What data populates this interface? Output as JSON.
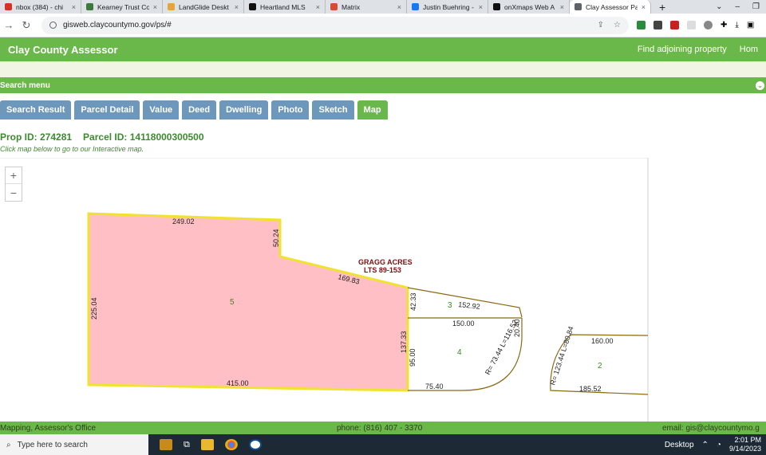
{
  "browser": {
    "tabs": [
      {
        "label": "nbox (384) - chi",
        "color": "#d93025"
      },
      {
        "label": "Kearney Trust Co",
        "color": "#3c7a3c"
      },
      {
        "label": "LandGlide Deskt",
        "color": "#e8a33d"
      },
      {
        "label": "Heartland MLS",
        "color": "#111111"
      },
      {
        "label": "Matrix",
        "color": "#d24e34"
      },
      {
        "label": "Justin Buehring -",
        "color": "#1877f2"
      },
      {
        "label": "onXmaps Web A",
        "color": "#111111"
      },
      {
        "label": "Clay Assessor Pa",
        "color": "#5f6368"
      }
    ],
    "url": "gisweb.claycountymo.gov/ps/#"
  },
  "app": {
    "title": "Clay County Assessor",
    "links": [
      "Find adjoining property",
      "Hom"
    ],
    "search_menu": "Search menu"
  },
  "nav_tabs": [
    "Search Result",
    "Parcel Detail",
    "Value",
    "Deed",
    "Dwelling",
    "Photo",
    "Sketch",
    "Map"
  ],
  "property": {
    "prop_id": "Prop ID: 274281",
    "parcel_id": "Parcel ID: 14118000300500",
    "hint": "Click map below to go to our Interactive map."
  },
  "map": {
    "subdivision": "GRAGG ACRES",
    "lots": "LTS 89-153",
    "lot_numbers": {
      "selected": "5",
      "lot3": "3",
      "lot4": "4",
      "lot2": "2"
    },
    "dims": {
      "top": "249.02",
      "notch": "50.24",
      "diag": "169.83",
      "left": "225.04",
      "bottom": "415.00",
      "right_upper": "42.33",
      "right_lower": "137.33",
      "l3_top": "152.92",
      "l3_bottom": "150.00",
      "l3_right": "20.40",
      "l4_left": "95.00",
      "l4_bottom": "75.40",
      "l4_curve": "R= 73.44 L=116.52",
      "l2_top": "160.00",
      "l2_curve": "R= 123.44 L=80.84",
      "l2_bottom": "185.52"
    },
    "colors": {
      "selected_fill": "#ffbfc4",
      "selected_stroke": "#f0e330",
      "line": "#8b6914",
      "lot_label": "#3a8a1e",
      "sub_label": "#7b1010"
    }
  },
  "footer": {
    "left": "Mapping, Assessor's Office",
    "phone": "phone: (816) 407 - 3370",
    "email": "email: gis@claycountymo.g"
  },
  "taskbar": {
    "search_placeholder": "Type here to search",
    "desktop": "Desktop",
    "time": "2:01 PM",
    "date": "9/14/2023"
  }
}
